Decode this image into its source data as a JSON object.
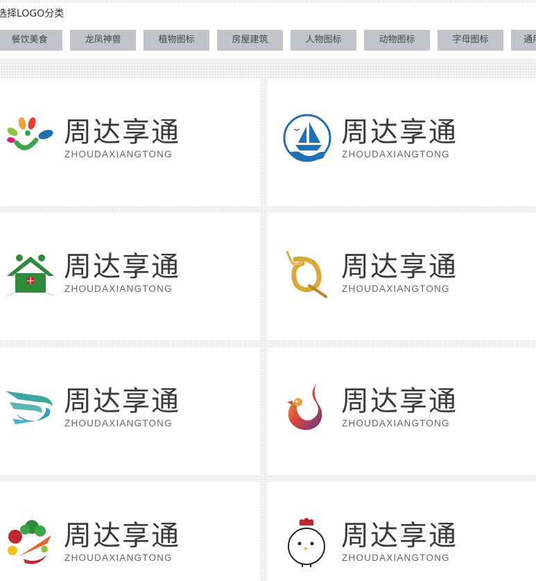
{
  "header": {
    "title": "选择LOGO分类"
  },
  "categories": [
    {
      "label": "餐饮美食"
    },
    {
      "label": "龙凤神兽"
    },
    {
      "label": "植物图标"
    },
    {
      "label": "房屋建筑"
    },
    {
      "label": "人物图标"
    },
    {
      "label": "动物图标"
    },
    {
      "label": "字母图标"
    },
    {
      "label": "通用"
    }
  ],
  "logos": [
    {
      "icon": "colorful-leaves-person-icon",
      "name_cn": "周达享通",
      "name_en": "ZHOUDAXIANGTONG"
    },
    {
      "icon": "sailboat-circle-icon",
      "name_cn": "周达享通",
      "name_en": "ZHOUDAXIANGTONG"
    },
    {
      "icon": "house-people-icon",
      "name_cn": "周达享通",
      "name_en": "ZHOUDAXIANGTONG"
    },
    {
      "icon": "golden-q-swirl-icon",
      "name_cn": "周达享通",
      "name_en": "ZHOUDAXIANGTONG"
    },
    {
      "icon": "bird-wing-swoosh-icon",
      "name_cn": "周达享通",
      "name_en": "ZHOUDAXIANGTONG"
    },
    {
      "icon": "phoenix-icon",
      "name_cn": "周达享通",
      "name_en": "ZHOUDAXIANGTONG"
    },
    {
      "icon": "vegetables-icon",
      "name_cn": "周达享通",
      "name_en": "ZHOUDAXIANGTONG"
    },
    {
      "icon": "chicken-icon",
      "name_cn": "周达享通",
      "name_en": "ZHOUDAXIANGTONG"
    }
  ],
  "colors": {
    "tab_bg": "#c1c5cb",
    "brand_text": "#3a3a3a",
    "sail_blue": "#1f6fb2",
    "house_green": "#2e8b3a",
    "gold": "#d9a93a"
  }
}
